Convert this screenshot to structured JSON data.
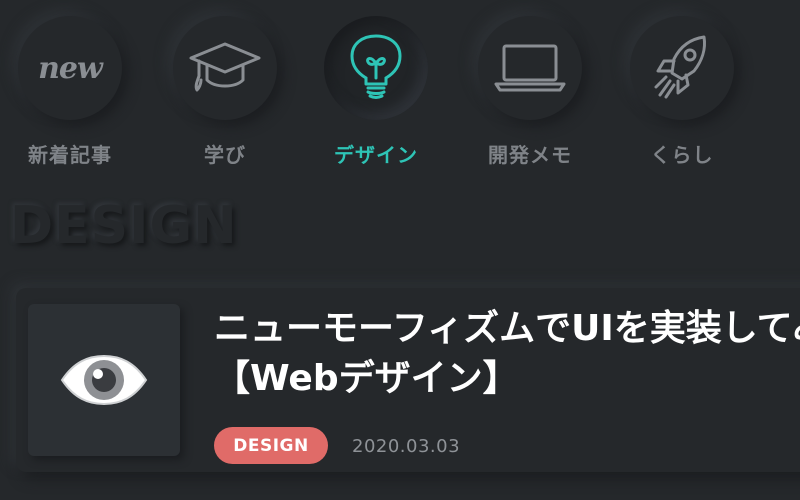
{
  "nav": {
    "items": [
      {
        "label": "新着記事",
        "icon": "new-icon",
        "icon_text": "new",
        "active": false
      },
      {
        "label": "学び",
        "icon": "graduation-cap-icon",
        "active": false
      },
      {
        "label": "デザイン",
        "icon": "lightbulb-icon",
        "active": true
      },
      {
        "label": "開発メモ",
        "icon": "laptop-icon",
        "active": false
      },
      {
        "label": "くらし",
        "icon": "rocket-icon",
        "active": false
      }
    ]
  },
  "section": {
    "title": "DESIGN"
  },
  "article": {
    "thumb_icon": "eye-icon",
    "title_line1": "ニューモーフィズムでUIを実装してみた",
    "title_line2": "【Webデザイン】",
    "category": "DESIGN",
    "date": "2020.03.03"
  },
  "colors": {
    "background": "#25282b",
    "accent": "#2ec4b6",
    "badge": "#e06b68",
    "muted_text": "#7f8388",
    "title_text": "#ffffff"
  }
}
